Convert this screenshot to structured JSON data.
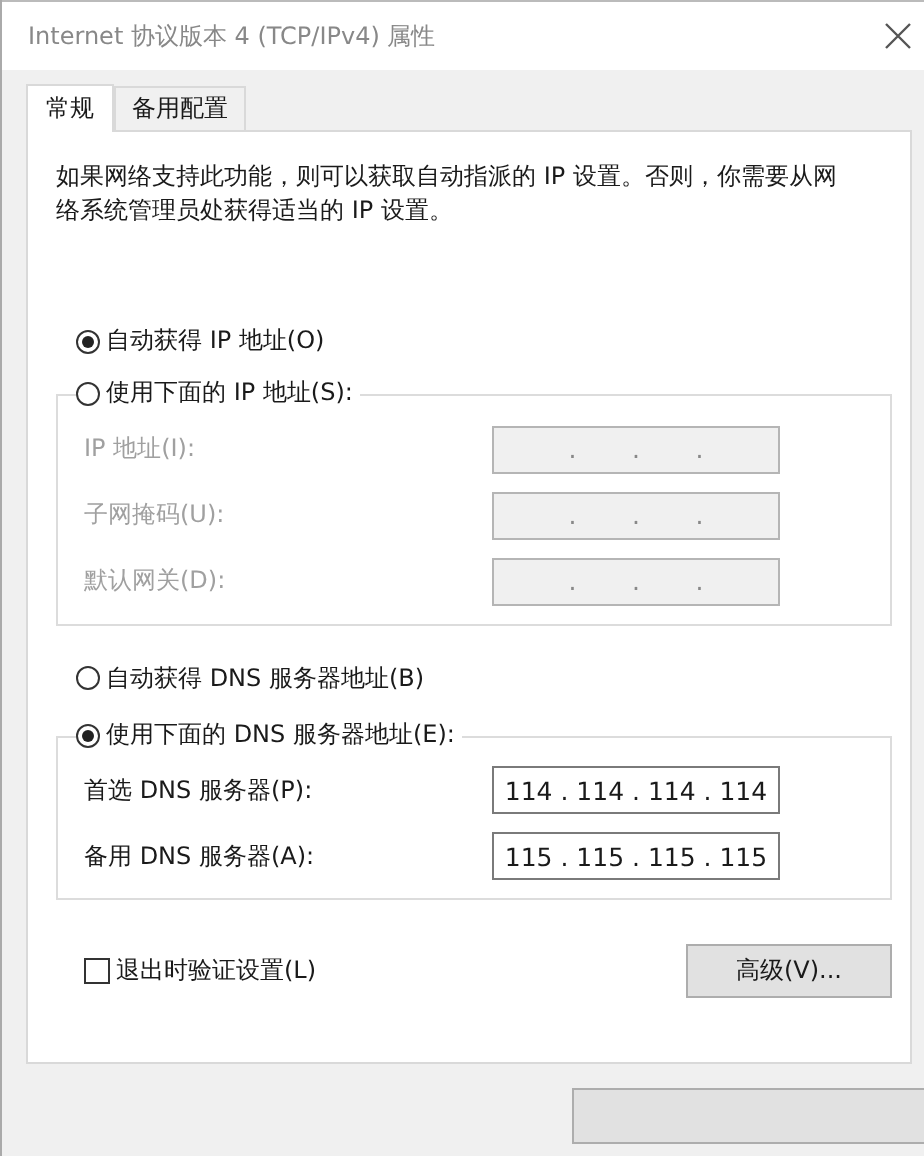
{
  "window": {
    "title": "Internet 协议版本 4 (TCP/IPv4) 属性"
  },
  "tabs": [
    {
      "label": "常规",
      "selected": true
    },
    {
      "label": "备用配置",
      "selected": false
    }
  ],
  "description": "如果网络支持此功能，则可以获取自动指派的 IP 设置。否则，你需要从网络系统管理员处获得适当的 IP 设置。",
  "ip_options": [
    {
      "label": "自动获得 IP 地址(O)",
      "selected": true
    },
    {
      "label": "使用下面的 IP 地址(S):",
      "selected": false
    }
  ],
  "ip_fields": [
    {
      "label": "IP 地址(I):",
      "value": ".       .       .",
      "disabled": true
    },
    {
      "label": "子网掩码(U):",
      "value": ".       .       .",
      "disabled": true
    },
    {
      "label": "默认网关(D):",
      "value": ".       .       .",
      "disabled": true
    }
  ],
  "dns_options": [
    {
      "label": "自动获得 DNS 服务器地址(B)",
      "selected": false
    },
    {
      "label": "使用下面的 DNS 服务器地址(E):",
      "selected": true
    }
  ],
  "dns_fields": [
    {
      "label": "首选 DNS 服务器(P):",
      "value": "114 . 114 . 114 . 114",
      "disabled": false
    },
    {
      "label": "备用 DNS 服务器(A):",
      "value": "115 . 115 . 115 . 115",
      "disabled": false
    }
  ],
  "validate_checkbox": {
    "label": "退出时验证设置(L)",
    "checked": false
  },
  "advanced_button": "高级(V)..."
}
